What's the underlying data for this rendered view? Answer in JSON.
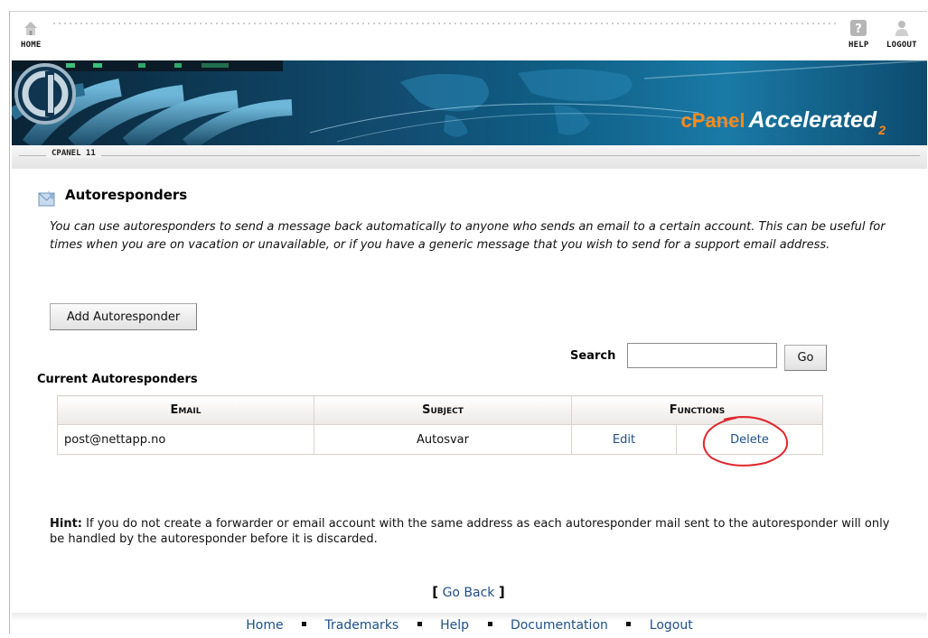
{
  "topnav": {
    "home_label": "HOME",
    "help_label": "HELP",
    "logout_label": "LOGOUT"
  },
  "banner": {
    "brand_cpanel": "cPanel",
    "brand_accelerated": "Accelerated",
    "brand_version": "2"
  },
  "version_tag": "CPANEL 11",
  "page": {
    "title": "Autoresponders",
    "description": "You can use autoresponders to send a message back automatically to anyone who sends an email to a certain account. This can be useful for times when you are on vacation or unavailable, or if you have a generic message that you wish to send for a support email address.",
    "add_button": "Add Autoresponder",
    "search_label": "Search",
    "search_value": "",
    "go_button": "Go",
    "current_title": "Current Autoresponders"
  },
  "table": {
    "headers": {
      "email": "Email",
      "subject": "Subject",
      "functions": "Functions"
    },
    "rows": [
      {
        "email": "post@nettapp.no",
        "subject": "Autosvar",
        "edit": "Edit",
        "delete": "Delete"
      }
    ]
  },
  "hint": {
    "label": "Hint:",
    "text": " If you do not create a forwarder or email account with the same address as each autoresponder mail sent to the autoresponder will only be handled by the autoresponder before it is discarded."
  },
  "goback": {
    "open": "[",
    "label": "Go Back",
    "close": "]"
  },
  "footer": {
    "links": [
      "Home",
      "Trademarks",
      "Help",
      "Documentation",
      "Logout"
    ]
  },
  "colors": {
    "link": "#1f4f86",
    "brand_orange": "#ff8a1a",
    "annotation_red": "#e0282e"
  },
  "icons": [
    "home-icon",
    "help-icon",
    "logout-icon",
    "autoresponder-icon",
    "cpanel-logo-icon"
  ]
}
